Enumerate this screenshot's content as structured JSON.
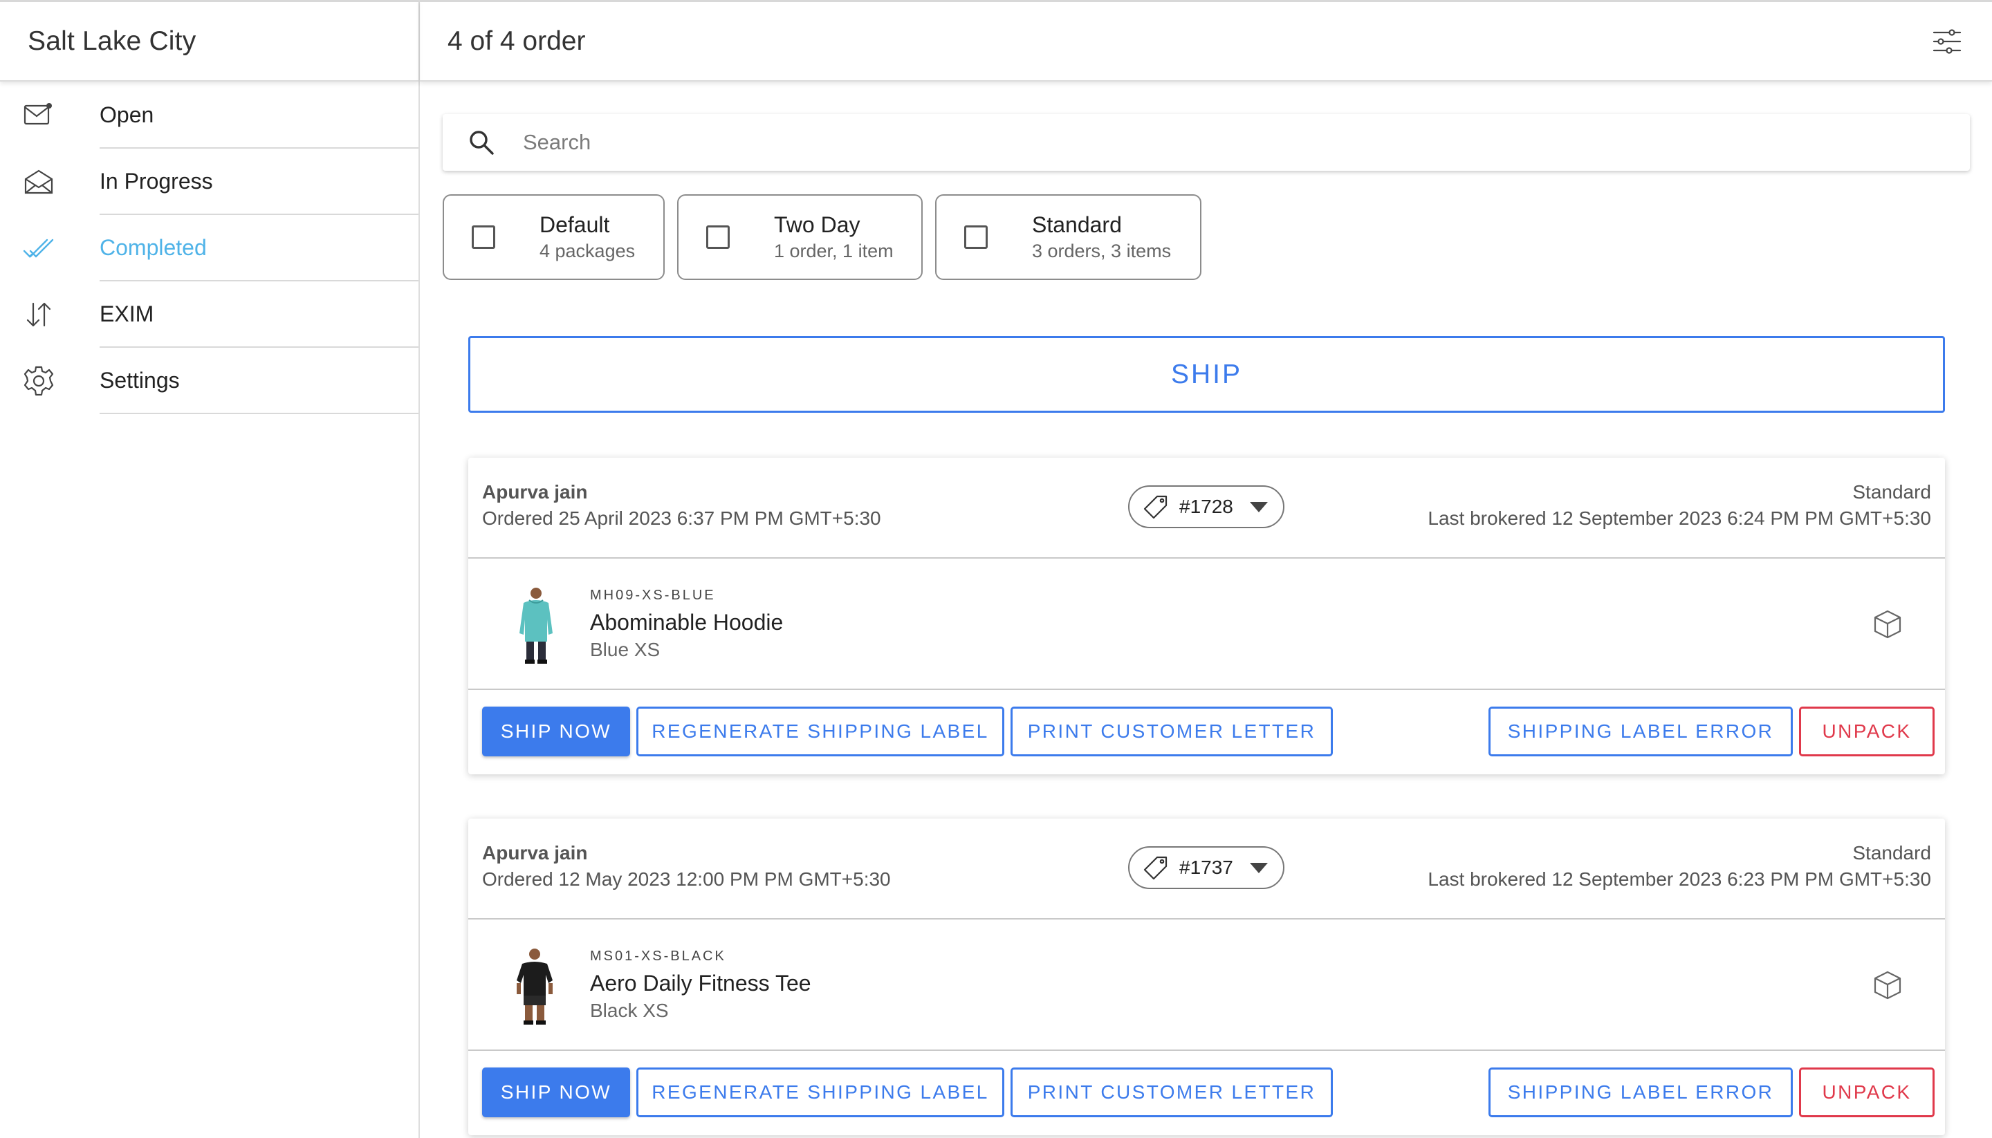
{
  "sidebar": {
    "title": "Salt Lake City",
    "items": [
      {
        "label": "Open",
        "icon": "mail-unread-icon"
      },
      {
        "label": "In Progress",
        "icon": "mail-open-icon"
      },
      {
        "label": "Completed",
        "icon": "double-check-icon"
      },
      {
        "label": "EXIM",
        "icon": "swap-vertical-icon"
      },
      {
        "label": "Settings",
        "icon": "gear-icon"
      }
    ],
    "active_index": 2
  },
  "header": {
    "title": "4 of 4 order",
    "filter_icon": "sliders-icon"
  },
  "search": {
    "placeholder": "Search",
    "value": ""
  },
  "shipment_methods": [
    {
      "title": "Default",
      "subtitle": "4 packages",
      "checked": false
    },
    {
      "title": "Two Day",
      "subtitle": "1 order, 1 item",
      "checked": false
    },
    {
      "title": "Standard",
      "subtitle": "3 orders, 3 items",
      "checked": false
    }
  ],
  "ship_button": "SHIP",
  "orders": [
    {
      "customer": "Apurva jain",
      "ordered": "Ordered 25 April 2023 6:37 PM PM GMT+5:30",
      "order_number": "#1728",
      "method": "Standard",
      "brokered": "Last brokered 12 September 2023 6:24 PM PM GMT+5:30",
      "item": {
        "sku": "MH09-XS-BLUE",
        "name": "Abominable Hoodie",
        "variant": "Blue XS"
      },
      "actions": {
        "ship_now": "SHIP NOW",
        "regenerate": "REGENERATE SHIPPING LABEL",
        "print_letter": "PRINT CUSTOMER LETTER",
        "label_error": "SHIPPING LABEL ERROR",
        "unpack": "UNPACK"
      }
    },
    {
      "customer": "Apurva jain",
      "ordered": "Ordered 12 May 2023 12:00 PM PM GMT+5:30",
      "order_number": "#1737",
      "method": "Standard",
      "brokered": "Last brokered 12 September 2023 6:23 PM PM GMT+5:30",
      "item": {
        "sku": "MS01-XS-BLACK",
        "name": "Aero Daily Fitness Tee",
        "variant": "Black XS"
      },
      "actions": {
        "ship_now": "SHIP NOW",
        "regenerate": "REGENERATE SHIPPING LABEL",
        "print_letter": "PRINT CUSTOMER LETTER",
        "label_error": "SHIPPING LABEL ERROR",
        "unpack": "UNPACK"
      }
    }
  ],
  "colors": {
    "primary": "#3c7bec",
    "active_nav": "#4fb3e8",
    "danger": "#e0394b",
    "hoodie": "#5cc1c0",
    "tee": "#1c1c1c"
  }
}
